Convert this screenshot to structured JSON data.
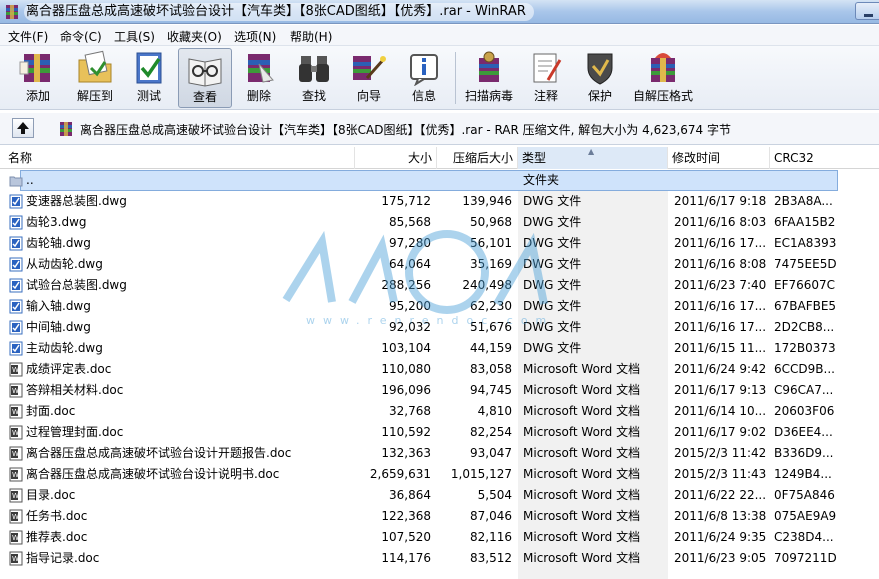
{
  "window": {
    "title": "离合器压盘总成高速破坏试验台设计【汽车类】【8张CAD图纸】【优秀】.rar - WinRAR"
  },
  "menu": [
    "文件(F)",
    "命令(C)",
    "工具(S)",
    "收藏夹(O)",
    "选项(N)",
    "帮助(H)"
  ],
  "toolbar": {
    "add": "添加",
    "extract": "解压到",
    "test": "测试",
    "view": "查看",
    "delete": "删除",
    "find": "查找",
    "wizard": "向导",
    "info": "信息",
    "virus": "扫描病毒",
    "comment": "注释",
    "protect": "保护",
    "sfx": "自解压格式"
  },
  "address": {
    "text": "离合器压盘总成高速破坏试验台设计【汽车类】【8张CAD图纸】【优秀】.rar - RAR 压缩文件, 解包大小为 4,623,674 字节"
  },
  "columns": {
    "name": "名称",
    "size": "大小",
    "packed": "压缩后大小",
    "type": "类型",
    "modified": "修改时间",
    "crc": "CRC32"
  },
  "watermark": {
    "text": "人人文库",
    "url": "www.renrendoc.com"
  },
  "colors": {
    "selection": "#cfe3fb",
    "titlebar": "#a9c6ea"
  },
  "files": [
    {
      "name": "..",
      "size": "",
      "packed": "",
      "type": "文件夹",
      "modified": "",
      "crc": "",
      "icon": "folder-up-icon"
    },
    {
      "name": "变速器总装图.dwg",
      "size": "175,712",
      "packed": "139,946",
      "type": "DWG 文件",
      "modified": "2011/6/17 9:18",
      "crc": "2B3A8A...",
      "icon": "dwg-file-icon"
    },
    {
      "name": "齿轮3.dwg",
      "size": "85,568",
      "packed": "50,968",
      "type": "DWG 文件",
      "modified": "2011/6/16 8:03",
      "crc": "6FAA15B2",
      "icon": "dwg-file-icon"
    },
    {
      "name": "齿轮轴.dwg",
      "size": "97,280",
      "packed": "56,101",
      "type": "DWG 文件",
      "modified": "2011/6/16 17...",
      "crc": "EC1A8393",
      "icon": "dwg-file-icon"
    },
    {
      "name": "从动齿轮.dwg",
      "size": "64,064",
      "packed": "35,169",
      "type": "DWG 文件",
      "modified": "2011/6/16 8:08",
      "crc": "7475EE5D",
      "icon": "dwg-file-icon"
    },
    {
      "name": "试验台总装图.dwg",
      "size": "288,256",
      "packed": "240,498",
      "type": "DWG 文件",
      "modified": "2011/6/23 7:40",
      "crc": "EF76607C",
      "icon": "dwg-file-icon"
    },
    {
      "name": "输入轴.dwg",
      "size": "95,200",
      "packed": "62,230",
      "type": "DWG 文件",
      "modified": "2011/6/16 17...",
      "crc": "67BAFBE5",
      "icon": "dwg-file-icon"
    },
    {
      "name": "中间轴.dwg",
      "size": "92,032",
      "packed": "51,676",
      "type": "DWG 文件",
      "modified": "2011/6/16 17...",
      "crc": "2D2CB8...",
      "icon": "dwg-file-icon"
    },
    {
      "name": "主动齿轮.dwg",
      "size": "103,104",
      "packed": "44,159",
      "type": "DWG 文件",
      "modified": "2011/6/15 11...",
      "crc": "172B0373",
      "icon": "dwg-file-icon"
    },
    {
      "name": "成绩评定表.doc",
      "size": "110,080",
      "packed": "83,058",
      "type": "Microsoft Word 文档",
      "modified": "2011/6/24 9:42",
      "crc": "6CCD9B...",
      "icon": "doc-file-icon"
    },
    {
      "name": "答辩相关材料.doc",
      "size": "196,096",
      "packed": "94,745",
      "type": "Microsoft Word 文档",
      "modified": "2011/6/17 9:13",
      "crc": "C96CA7...",
      "icon": "doc-file-icon"
    },
    {
      "name": "封面.doc",
      "size": "32,768",
      "packed": "4,810",
      "type": "Microsoft Word 文档",
      "modified": "2011/6/14 10...",
      "crc": "20603F06",
      "icon": "doc-file-icon"
    },
    {
      "name": "过程管理封面.doc",
      "size": "110,592",
      "packed": "82,254",
      "type": "Microsoft Word 文档",
      "modified": "2011/6/17 9:02",
      "crc": "D36EE4...",
      "icon": "doc-file-icon"
    },
    {
      "name": "离合器压盘总成高速破坏试验台设计开题报告.doc",
      "size": "132,363",
      "packed": "93,047",
      "type": "Microsoft Word 文档",
      "modified": "2015/2/3 11:42",
      "crc": "B336D9...",
      "icon": "doc-file-icon"
    },
    {
      "name": "离合器压盘总成高速破坏试验台设计说明书.doc",
      "size": "2,659,631",
      "packed": "1,015,127",
      "type": "Microsoft Word 文档",
      "modified": "2015/2/3 11:43",
      "crc": "1249B4...",
      "icon": "doc-file-icon"
    },
    {
      "name": "目录.doc",
      "size": "36,864",
      "packed": "5,504",
      "type": "Microsoft Word 文档",
      "modified": "2011/6/22 22...",
      "crc": "0F75A846",
      "icon": "doc-file-icon"
    },
    {
      "name": "任务书.doc",
      "size": "122,368",
      "packed": "87,046",
      "type": "Microsoft Word 文档",
      "modified": "2011/6/8 13:38",
      "crc": "075AE9A9",
      "icon": "doc-file-icon"
    },
    {
      "name": "推荐表.doc",
      "size": "107,520",
      "packed": "82,116",
      "type": "Microsoft Word 文档",
      "modified": "2011/6/24 9:35",
      "crc": "C238D4...",
      "icon": "doc-file-icon"
    },
    {
      "name": "指导记录.doc",
      "size": "114,176",
      "packed": "83,512",
      "type": "Microsoft Word 文档",
      "modified": "2011/6/23 9:05",
      "crc": "7097211D",
      "icon": "doc-file-icon"
    }
  ]
}
